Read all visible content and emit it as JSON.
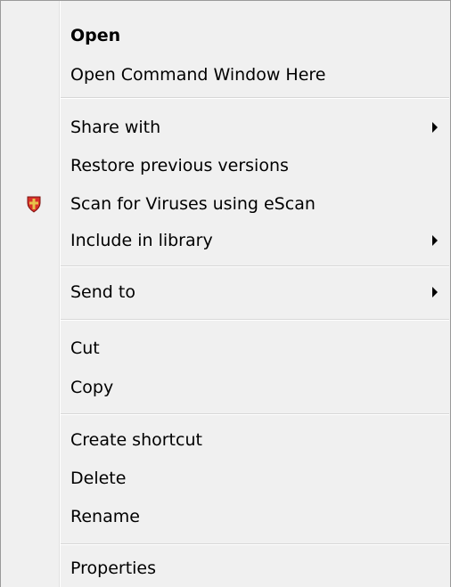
{
  "menu": {
    "items": [
      {
        "label": "Open"
      },
      {
        "label": "Open Command Window Here"
      },
      {
        "label": "Share with"
      },
      {
        "label": "Restore previous versions"
      },
      {
        "label": "Scan for Viruses using eScan",
        "icon": "escan-shield-icon"
      },
      {
        "label": "Include in library"
      },
      {
        "label": "Send to"
      },
      {
        "label": "Cut"
      },
      {
        "label": "Copy"
      },
      {
        "label": "Create shortcut"
      },
      {
        "label": "Delete"
      },
      {
        "label": "Rename"
      },
      {
        "label": "Properties"
      }
    ]
  },
  "colors": {
    "menu_background": "#f0f0f0",
    "separator": "#d7d7d7",
    "escan_red": "#d9302a",
    "escan_gold": "#e7c24a"
  }
}
